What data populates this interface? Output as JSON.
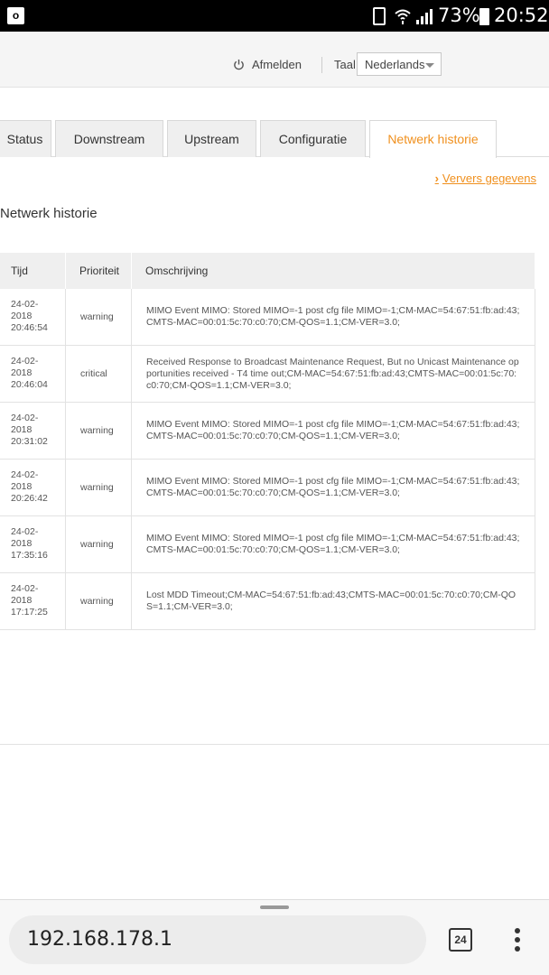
{
  "statusbar": {
    "battery_pct": "73%",
    "time": "20:52",
    "icons": [
      "outlook-icon",
      "battery-saver-icon",
      "wifi-icon",
      "signal-icon",
      "battery-icon"
    ]
  },
  "header": {
    "logout_label": "Afmelden",
    "lang_label": "Taal",
    "lang_value": "Nederlands"
  },
  "tabs": [
    "Status",
    "Downstream",
    "Upstream",
    "Configuratie",
    "Netwerk historie"
  ],
  "active_tab": "Netwerk historie",
  "refresh_label": "Ververs gegevens",
  "page_title": "Netwerk historie",
  "table": {
    "headers": [
      "Tijd",
      "Prioriteit",
      "Omschrijving"
    ],
    "rows": [
      {
        "date": "24-02-",
        "year": "2018",
        "time": "20:46:54",
        "priority": "warning",
        "desc": "MIMO Event MIMO: Stored MIMO=-1 post cfg file MIMO=-1;CM-MAC=54:67:51:fb:ad:43;CMTS-MAC=00:01:5c:70:c0:70;CM-QOS=1.1;CM-VER=3.0;"
      },
      {
        "date": "24-02-",
        "year": "2018",
        "time": "20:46:04",
        "priority": "critical",
        "desc": "Received Response to Broadcast Maintenance Request, But no Unicast Maintenance opportunities received - T4 time out;CM-MAC=54:67:51:fb:ad:43;CMTS-MAC=00:01:5c:70:c0:70;CM-QOS=1.1;CM-VER=3.0;"
      },
      {
        "date": "24-02-",
        "year": "2018",
        "time": "20:31:02",
        "priority": "warning",
        "desc": "MIMO Event MIMO: Stored MIMO=-1 post cfg file MIMO=-1;CM-MAC=54:67:51:fb:ad:43;CMTS-MAC=00:01:5c:70:c0:70;CM-QOS=1.1;CM-VER=3.0;"
      },
      {
        "date": "24-02-",
        "year": "2018",
        "time": "20:26:42",
        "priority": "warning",
        "desc": "MIMO Event MIMO: Stored MIMO=-1 post cfg file MIMO=-1;CM-MAC=54:67:51:fb:ad:43;CMTS-MAC=00:01:5c:70:c0:70;CM-QOS=1.1;CM-VER=3.0;"
      },
      {
        "date": "24-02-",
        "year": "2018",
        "time": "17:35:16",
        "priority": "warning",
        "desc": "MIMO Event MIMO: Stored MIMO=-1 post cfg file MIMO=-1;CM-MAC=54:67:51:fb:ad:43;CMTS-MAC=00:01:5c:70:c0:70;CM-QOS=1.1;CM-VER=3.0;"
      },
      {
        "date": "24-02-",
        "year": "2018",
        "time": "17:17:25",
        "priority": "warning",
        "desc": "Lost MDD Timeout;CM-MAC=54:67:51:fb:ad:43;CMTS-MAC=00:01:5c:70:c0:70;CM-QOS=1.1;CM-VER=3.0;"
      }
    ]
  },
  "browser": {
    "url": "192.168.178.1",
    "tab_count": "24"
  },
  "colors": {
    "accent": "#f0901e",
    "header_bg": "#f5f5f5",
    "tab_bg": "#efefef"
  }
}
